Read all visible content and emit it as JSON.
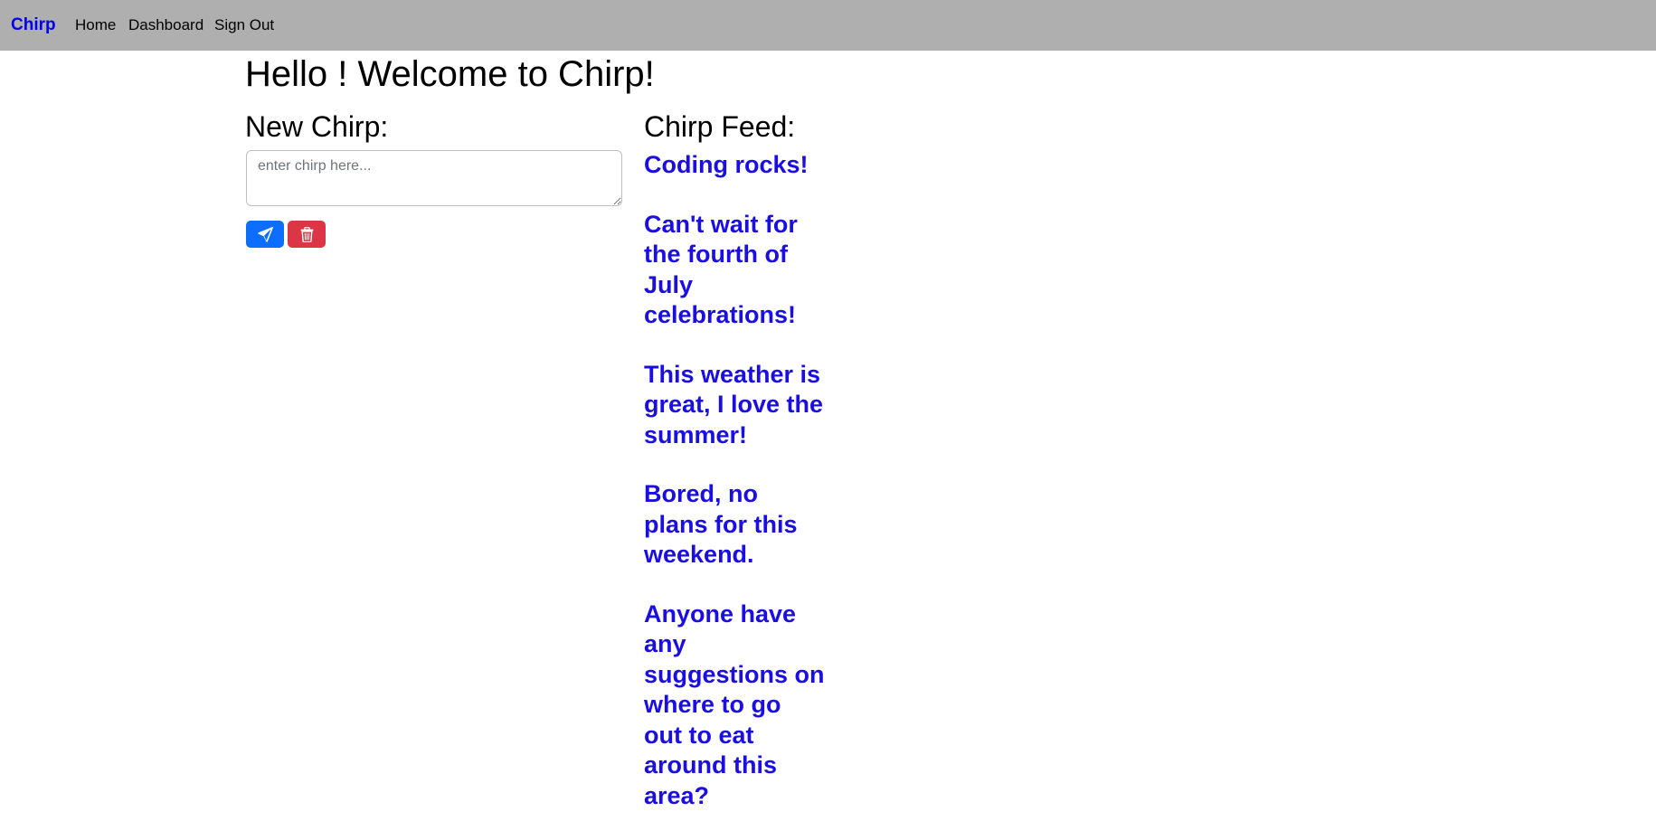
{
  "navbar": {
    "brand": "Chirp",
    "links": [
      "Home",
      "Dashboard",
      "Sign Out"
    ]
  },
  "main": {
    "greeting": "Hello ! Welcome to Chirp!",
    "new_chirp_title": "New Chirp:",
    "input_placeholder": "enter chirp here...",
    "input_value": "",
    "feed_title": "Chirp Feed:"
  },
  "buttons": {
    "send_icon": "paper-plane-icon",
    "delete_icon": "trash-icon"
  },
  "feed": [
    "Coding rocks!",
    "Can't wait for the fourth of July celebrations!",
    "This weather is great, I love the summer!",
    "Bored, no plans for this weekend.",
    "Anyone have any suggestions on where to go out to eat around this area?"
  ],
  "colors": {
    "navbar_bg": "#afafaf",
    "brand": "#0000ee",
    "feed_text": "#1a0fe0",
    "send_button": "#0d6efd",
    "delete_button": "#dc3545"
  }
}
